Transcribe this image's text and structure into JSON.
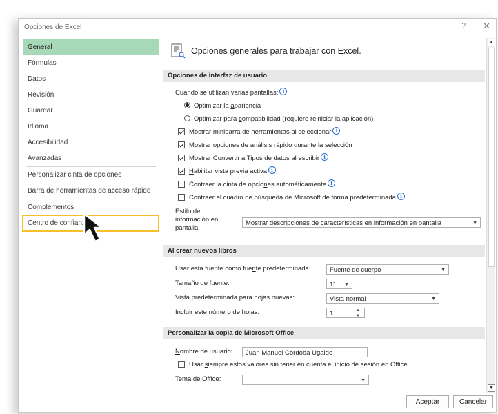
{
  "window": {
    "title": "Opciones de Excel",
    "help_label": "?",
    "close_label": "✕"
  },
  "sidebar": {
    "items": [
      {
        "label": "General"
      },
      {
        "label": "Fórmulas"
      },
      {
        "label": "Datos"
      },
      {
        "label": "Revisión"
      },
      {
        "label": "Guardar"
      },
      {
        "label": "Idioma"
      },
      {
        "label": "Accesibilidad"
      },
      {
        "label": "Avanzadas"
      },
      {
        "label": "Personalizar cinta de opciones"
      },
      {
        "label": "Barra de herramientas de acceso rápido"
      },
      {
        "label": "Complementos"
      },
      {
        "label": "Centro de confianza"
      }
    ],
    "selected": "General",
    "highlighted": "Centro de confianza"
  },
  "main": {
    "header": "Opciones generales para trabajar con Excel.",
    "ui_section": {
      "title": "Opciones de interfaz de usuario",
      "multi_screen_label": "Cuando se utilizan varias pantallas:",
      "radio_optimize_appearance": {
        "pre": "Optimizar la ",
        "u": "a",
        "post": "pariencia"
      },
      "radio_optimize_compat": {
        "pre": "Optimizar para ",
        "u": "c",
        "post": "ompatibilidad (requiere reiniciar la aplicación)"
      },
      "checks": {
        "mini_toolbar": {
          "pre": "Mostrar ",
          "u": "m",
          "post": "inibarra de herramientas al seleccionar"
        },
        "quick_analysis": {
          "pre": "",
          "u": "M",
          "post": "ostrar opciones de análisis rápido durante la selección"
        },
        "convert_types": {
          "pre": "Mostrar Convertir a ",
          "u": "T",
          "post": "ipos de datos al escribir"
        },
        "live_preview": {
          "pre": "",
          "u": "H",
          "post": "abilitar vista previa activa"
        },
        "collapse_ribbon": {
          "pre": "Contraer la cinta de opcio",
          "u": "n",
          "post": "es automáticamente"
        },
        "collapse_search": {
          "pre": "Contraer el cuadro de búsqueda de Microsoft de forma predeterminada",
          "u": "",
          "post": ""
        }
      },
      "tooltip_style_label_1": "Estilo de",
      "tooltip_style_label_2": "información en",
      "tooltip_style_label_3": "pantalla:",
      "tooltip_style_value": "Mostrar descripciones de características en información en pantalla"
    },
    "new_books_section": {
      "title": "Al crear nuevos libros",
      "font_label": {
        "pre": "Usar esta fuente como fue",
        "u": "n",
        "post": "te predeterminada:"
      },
      "font_value": "Fuente de cuerpo",
      "size_label": {
        "pre": "",
        "u": "T",
        "post": "amaño de fuente:"
      },
      "size_value": "11",
      "view_label": "Vista predeterminada para hojas nuevas:",
      "view_value": "Vista normal",
      "sheets_label": {
        "pre": "Incluir este número de ",
        "u": "h",
        "post": "ojas:"
      },
      "sheets_value": "1"
    },
    "office_section": {
      "title": "Personalizar la copia de Microsoft Office",
      "username_label": {
        "pre": "",
        "u": "N",
        "post": "ombre de usuario:"
      },
      "username_value": "Juan Manuel Córdoba Ugalde",
      "always_use": {
        "pre": "Usar ",
        "u": "s",
        "post": "iempre estos valores sin tener en cuenta el inicio de sesión en Office."
      },
      "theme_label": {
        "pre": "",
        "u": "T",
        "post": "ema de Office:"
      },
      "theme_value": ""
    }
  },
  "footer": {
    "ok_label": "Aceptar",
    "cancel_label": "Cancelar"
  },
  "states": {
    "radio_appearance_on": true,
    "radio_compat_on": false,
    "mini_toolbar": true,
    "quick_analysis": true,
    "convert_types": true,
    "live_preview": true,
    "collapse_ribbon": false,
    "collapse_search": false,
    "always_use": false
  },
  "colors": {
    "selected_nav_bg": "#a7d8b8",
    "highlight_border": "#f6c02d",
    "section_bar_bg": "#e7e7e7",
    "info_icon": "#2b6cd4"
  }
}
